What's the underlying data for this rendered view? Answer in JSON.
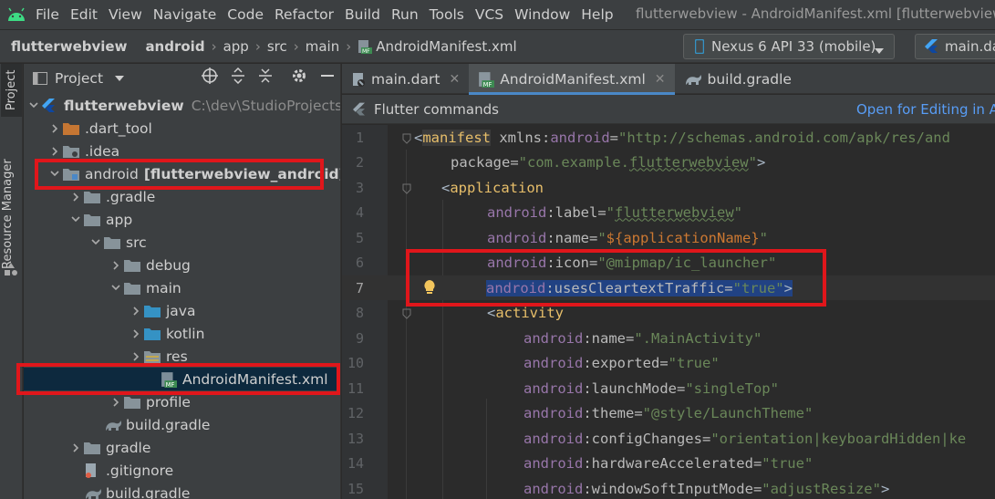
{
  "menubar": {
    "items": [
      "File",
      "Edit",
      "View",
      "Navigate",
      "Code",
      "Refactor",
      "Build",
      "Run",
      "Tools",
      "VCS",
      "Window",
      "Help"
    ],
    "window_title": "flutterwebview - AndroidManifest.xml [flutterwebview_and"
  },
  "navbar": {
    "crumbs": [
      "flutterwebview",
      "android",
      "app",
      "src",
      "main"
    ],
    "file": "AndroidManifest.xml",
    "device": "Nexus 6 API 33 (mobile)",
    "run_config": "main.da"
  },
  "left_strip": {
    "project_tab": "Project",
    "resource_tab": "Resource Manager"
  },
  "project_panel": {
    "title": "Project",
    "root": {
      "label": "flutterwebview",
      "path": "C:\\dev\\StudioProjects\\flu"
    },
    "rows": [
      {
        "label": ".dart_tool"
      },
      {
        "label": ".idea"
      },
      {
        "label": "android",
        "module": "[flutterwebview_android]"
      },
      {
        "label": ".gradle"
      },
      {
        "label": "app"
      },
      {
        "label": "src"
      },
      {
        "label": "debug"
      },
      {
        "label": "main"
      },
      {
        "label": "java"
      },
      {
        "label": "kotlin"
      },
      {
        "label": "res"
      },
      {
        "label": "AndroidManifest.xml"
      },
      {
        "label": "profile"
      },
      {
        "label": "build.gradle"
      },
      {
        "label": "gradle"
      },
      {
        "label": ".gitignore"
      },
      {
        "label": "build.gradle"
      }
    ]
  },
  "editor": {
    "tabs": [
      {
        "label": "main.dart"
      },
      {
        "label": "AndroidManifest.xml"
      },
      {
        "label": "build.gradle"
      }
    ],
    "flutter_commands": "Flutter commands",
    "open_for_editing": "Open for Editing in An",
    "line_numbers": [
      "1",
      "2",
      "3",
      "4",
      "5",
      "6",
      "7",
      "8",
      "9",
      "10",
      "11",
      "12",
      "13",
      "14",
      "15"
    ]
  },
  "colors": {
    "accent": "#4a88c7",
    "highlight": "#e0161b",
    "selection": "#214283"
  }
}
